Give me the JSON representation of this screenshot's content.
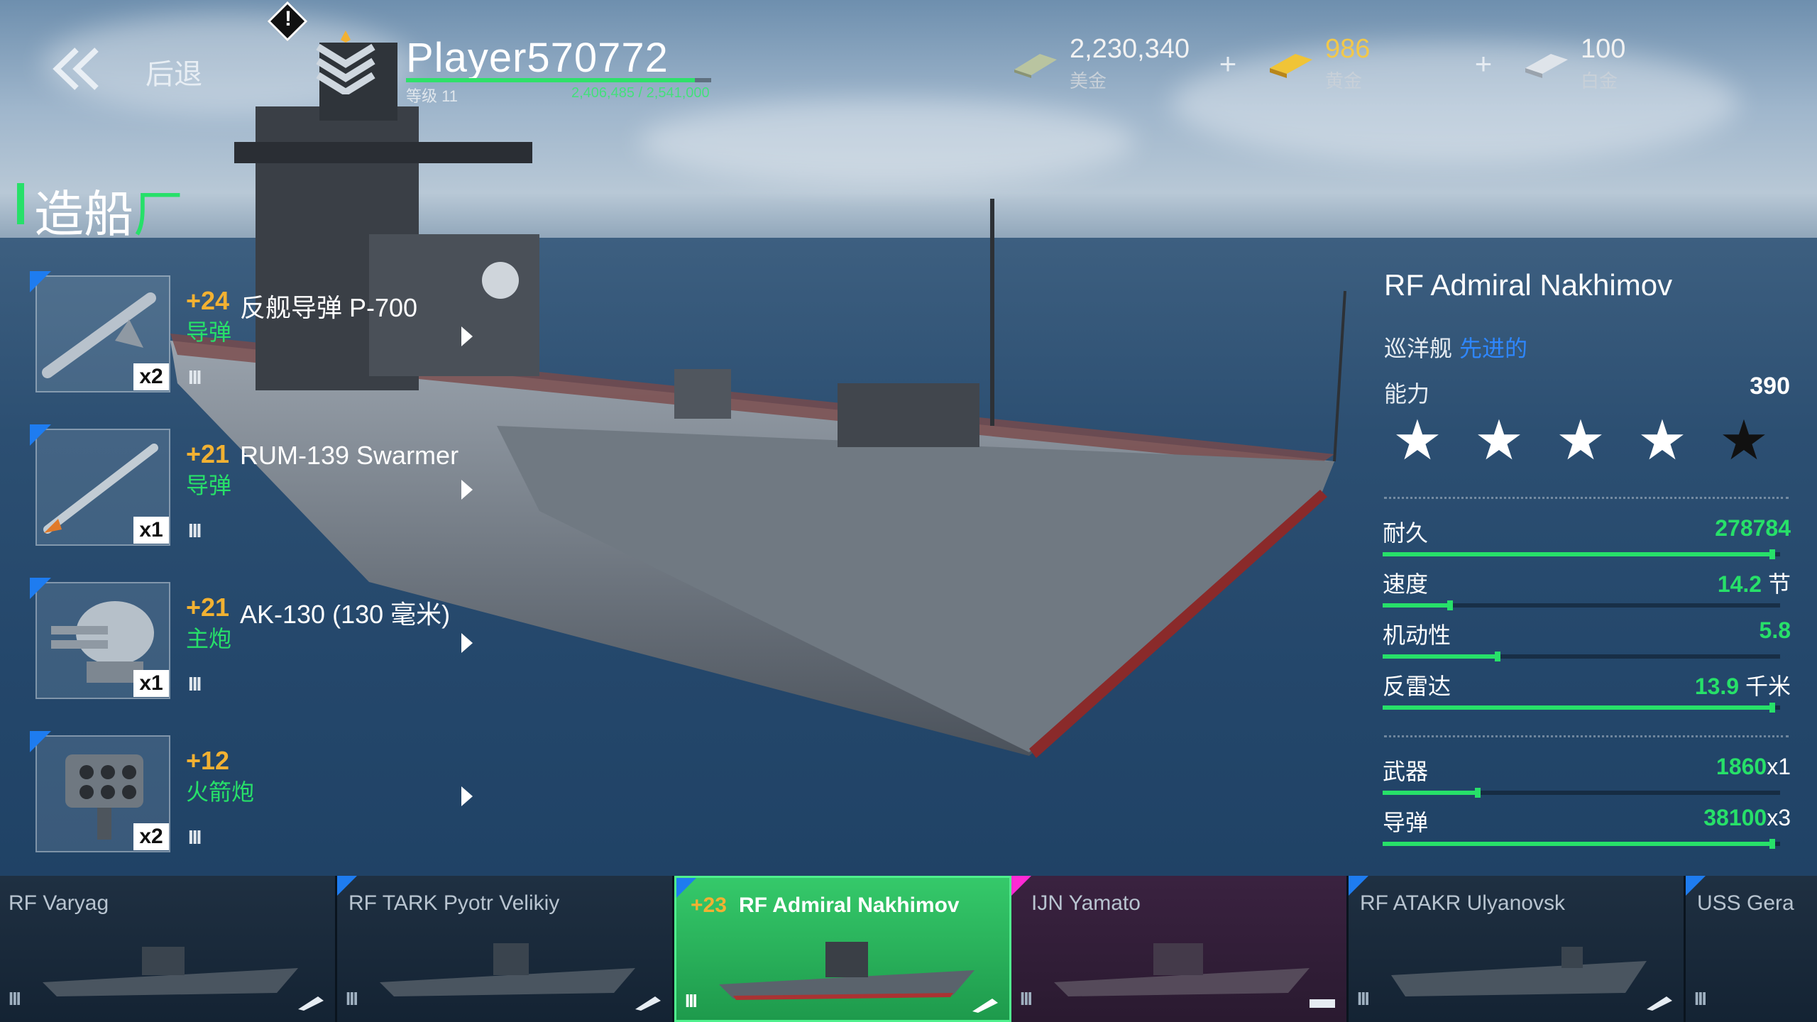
{
  "header": {
    "back_label": "后退",
    "player_name": "Player570772",
    "level_label": "等级 11",
    "xp_text": "2,406,485 / 2,541,000",
    "xp_fraction": 0.947
  },
  "currencies": [
    {
      "value": "2,230,340",
      "label": "美金",
      "icon": "dollar-bills-icon"
    },
    {
      "value": "986",
      "label": "黄金",
      "icon": "gold-bars-icon"
    },
    {
      "value": "100",
      "label": "白金",
      "icon": "platinum-bars-icon"
    }
  ],
  "title": {
    "main": "造船",
    "accent": "厂"
  },
  "weapons": [
    {
      "level": "+24",
      "name": "反舰导弹 P-700",
      "type": "导弹",
      "count": "x2",
      "tier": "III",
      "icon": "anti-ship-missile-icon"
    },
    {
      "level": "+21",
      "name": "RUM-139 Swarmer",
      "type": "导弹",
      "count": "x1",
      "tier": "III",
      "icon": "missile-icon"
    },
    {
      "level": "+21",
      "name": "AK-130 (130 毫米)",
      "type": "主炮",
      "count": "x1",
      "tier": "III",
      "icon": "main-gun-turret-icon"
    },
    {
      "level": "+12",
      "name": "",
      "type": "火箭炮",
      "count": "x2",
      "tier": "III",
      "icon": "rocket-launcher-icon"
    }
  ],
  "ship": {
    "name": "RF Admiral Nakhimov",
    "class": "巡洋舰",
    "grade": "先进的",
    "ability_label": "能力",
    "ability_value": "390",
    "stars_filled": 4,
    "stars_total": 5
  },
  "stats": [
    {
      "label": "耐久",
      "value": "278784",
      "unit": "",
      "fraction": 0.98
    },
    {
      "label": "速度",
      "value": "14.2",
      "unit": "节",
      "fraction": 0.17
    },
    {
      "label": "机动性",
      "value": "5.8",
      "unit": "",
      "fraction": 0.29
    },
    {
      "label": "反雷达",
      "value": "13.9",
      "unit": "千米",
      "fraction": 0.98
    }
  ],
  "weapon_stats": [
    {
      "label": "武器",
      "value": "1860",
      "unit": "x1",
      "fraction": 0.24
    },
    {
      "label": "导弹",
      "value": "38100",
      "unit": "x3",
      "fraction": 0.98
    }
  ],
  "ship_list": [
    {
      "level": "",
      "name": "RF Varyag",
      "tier": "III",
      "selected": false,
      "corner": "none"
    },
    {
      "level": "",
      "name": "RF TARK Pyotr Velikiy",
      "tier": "III",
      "selected": false,
      "corner": "blue"
    },
    {
      "level": "+23",
      "name": "RF Admiral Nakhimov",
      "tier": "III",
      "selected": true,
      "corner": "blue"
    },
    {
      "level": "",
      "name": "IJN Yamato",
      "tier": "III",
      "selected": false,
      "corner": "pink"
    },
    {
      "level": "",
      "name": "RF ATAKR Ulyanovsk",
      "tier": "III",
      "selected": false,
      "corner": "blue"
    },
    {
      "level": "",
      "name": "USS Gera",
      "tier": "III",
      "selected": false,
      "corner": "blue"
    }
  ],
  "colors": {
    "accent_green": "#27e069",
    "level_orange": "#f2b132",
    "grade_blue": "#2e87ff",
    "corner_blue": "#1e7cf0",
    "corner_pink": "#ff2ad4"
  }
}
